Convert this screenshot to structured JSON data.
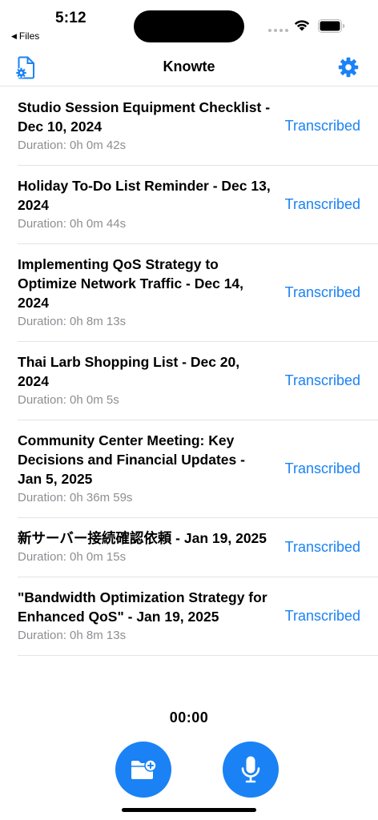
{
  "status_bar": {
    "time": "5:12",
    "back_app": "Files"
  },
  "nav": {
    "title": "Knowte"
  },
  "recordings": [
    {
      "title": "Studio Session Equipment Checklist - Dec 10, 2024",
      "duration": "Duration: 0h 0m 42s",
      "status": "Transcribed"
    },
    {
      "title": "Holiday To-Do List Reminder - Dec 13, 2024",
      "duration": "Duration: 0h 0m 44s",
      "status": "Transcribed"
    },
    {
      "title": "Implementing QoS Strategy to Optimize Network Traffic - Dec 14, 2024",
      "duration": "Duration: 0h 8m 13s",
      "status": "Transcribed"
    },
    {
      "title": "Thai Larb Shopping List - Dec 20, 2024",
      "duration": "Duration: 0h 0m 5s",
      "status": "Transcribed"
    },
    {
      "title": "Community Center Meeting: Key Decisions and Financial Updates - Jan 5, 2025",
      "duration": "Duration: 0h 36m 59s",
      "status": "Transcribed"
    },
    {
      "title": "新サーバー接続確認依頼 - Jan 19, 2025",
      "duration": "Duration: 0h 0m 15s",
      "status": "Transcribed"
    },
    {
      "title": "\"Bandwidth Optimization Strategy for Enhanced QoS\" - Jan 19, 2025",
      "duration": "Duration: 0h 8m 13s",
      "status": "Transcribed"
    }
  ],
  "recorder": {
    "timer": "00:00"
  },
  "icons": {
    "doc_settings": "document-gear-icon",
    "settings": "gear-icon",
    "import": "folder-plus-icon",
    "record": "microphone-icon"
  },
  "colors": {
    "accent": "#1a82f5",
    "secondary_text": "#8e8e93",
    "separator": "#e4e4e6"
  }
}
